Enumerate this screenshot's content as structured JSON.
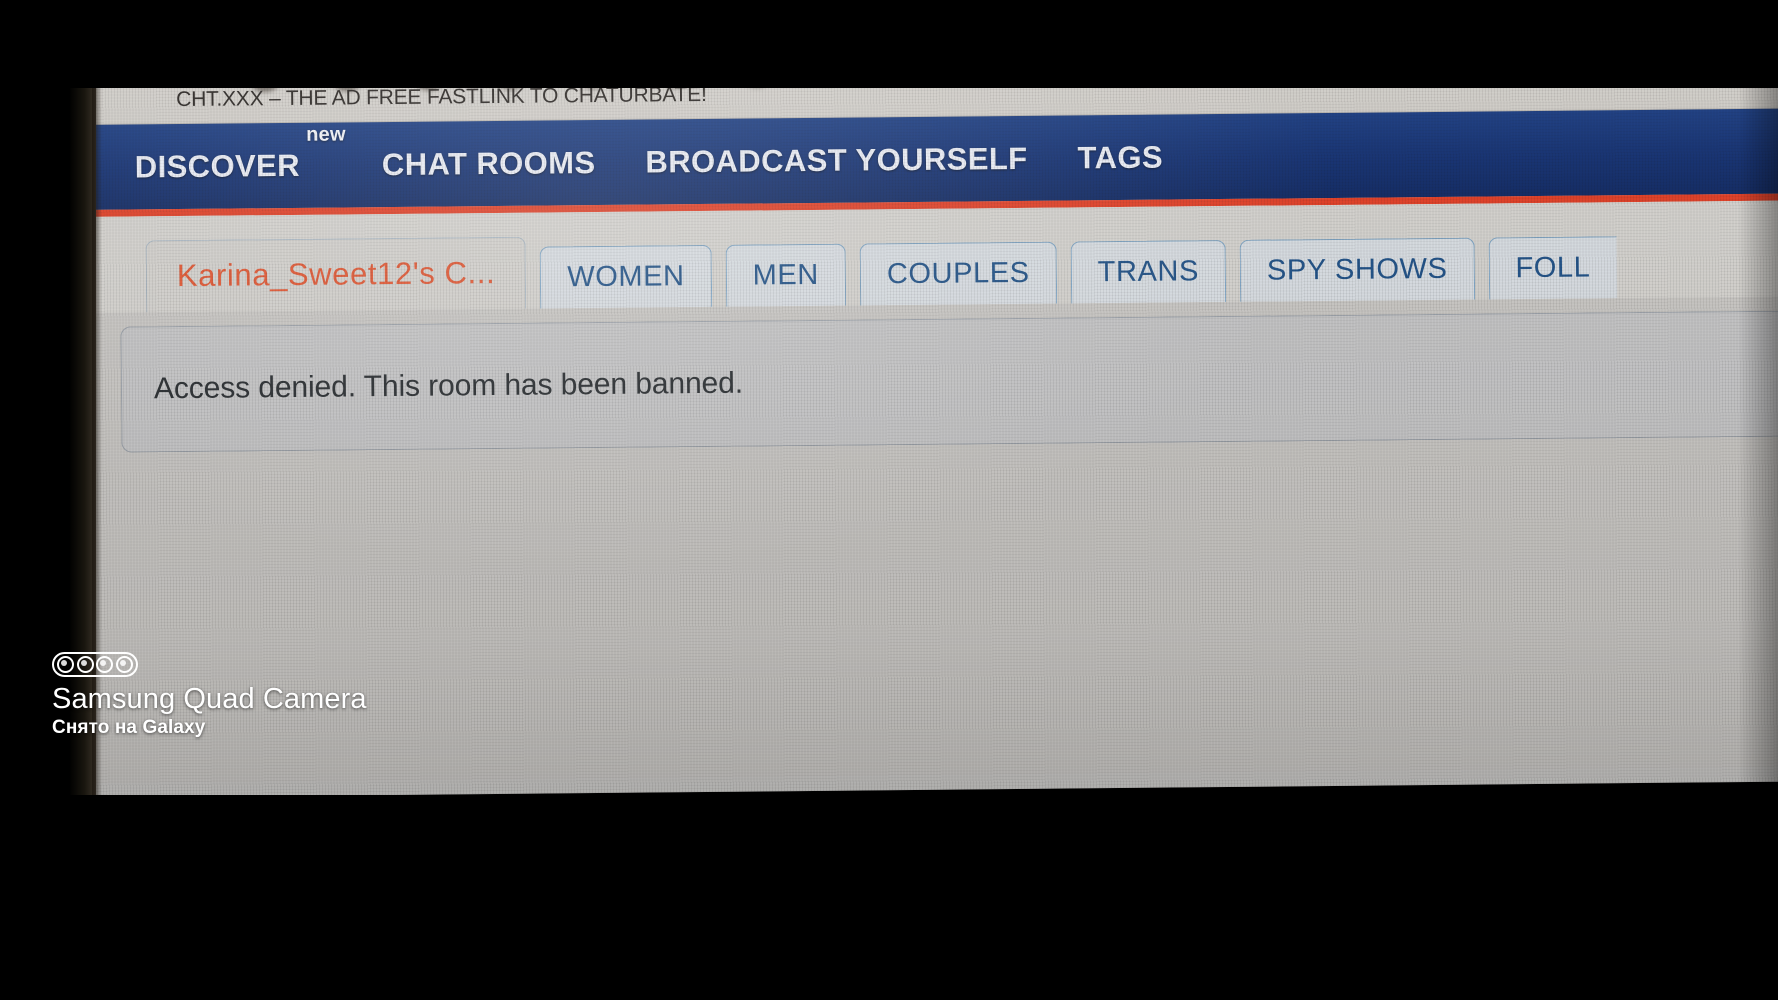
{
  "promo": {
    "text": "CHT.XXX – THE AD FREE FASTLINK TO CHATURBATE!",
    "gradient_start": "#1a6fd6",
    "gradient_end": "#e0362e"
  },
  "nav": {
    "background_color": "#0f2c6e",
    "accent_underline_color": "#e03b22",
    "items": [
      {
        "label": "DISCOVER",
        "badge": "new"
      },
      {
        "label": "CHAT ROOMS",
        "badge": ""
      },
      {
        "label": "BROADCAST YOURSELF",
        "badge": ""
      },
      {
        "label": "TAGS",
        "badge": ""
      }
    ]
  },
  "tabs": {
    "active_color": "#e0522d",
    "inactive_color": "#1d4f86",
    "items": [
      {
        "label": "Karina_Sweet12's C...",
        "active": true,
        "cut_off": false
      },
      {
        "label": "WOMEN",
        "active": false,
        "cut_off": false
      },
      {
        "label": "MEN",
        "active": false,
        "cut_off": false
      },
      {
        "label": "COUPLES",
        "active": false,
        "cut_off": false
      },
      {
        "label": "TRANS",
        "active": false,
        "cut_off": false
      },
      {
        "label": "SPY SHOWS",
        "active": false,
        "cut_off": false
      },
      {
        "label": "FOLL",
        "active": false,
        "cut_off": true
      }
    ]
  },
  "message": {
    "text": "Access denied. This room has been banned."
  },
  "watermark": {
    "title": "Samsung Quad Camera",
    "subtitle": "Снято на Galaxy",
    "lens_count": 4
  }
}
